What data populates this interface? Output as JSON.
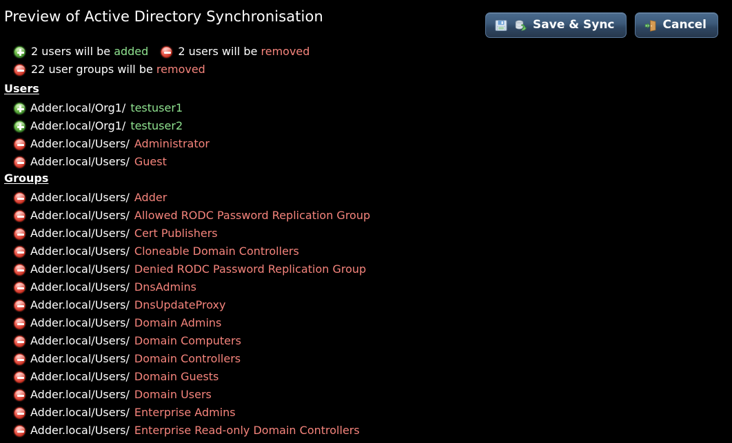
{
  "header": {
    "title": "Preview of Active Directory Synchronisation",
    "buttons": [
      {
        "label": "Save & Sync",
        "icons": [
          "floppy-disk-save-icon",
          "sync-refresh-icon"
        ]
      },
      {
        "label": "Cancel",
        "icons": [
          "exit-door-icon"
        ]
      }
    ]
  },
  "summary": {
    "lines": [
      [
        {
          "icon": "plus-circle-icon",
          "type": "add",
          "pre": "2 users will be ",
          "keyword": "added"
        },
        {
          "icon": "minus-circle-icon",
          "type": "del",
          "pre": "2 users will be ",
          "keyword": "removed"
        }
      ],
      [
        {
          "icon": "minus-circle-icon",
          "type": "del",
          "pre": "22 user groups will be ",
          "keyword": "removed"
        }
      ]
    ]
  },
  "sections": [
    {
      "title": "Users",
      "entries": [
        {
          "icon": "plus-circle-icon",
          "type": "add",
          "path": "Adder.local/Org1/",
          "name": "testuser1"
        },
        {
          "icon": "plus-circle-icon",
          "type": "add",
          "path": "Adder.local/Org1/",
          "name": "testuser2"
        },
        {
          "icon": "minus-circle-icon",
          "type": "del",
          "path": "Adder.local/Users/",
          "name": "Administrator"
        },
        {
          "icon": "minus-circle-icon",
          "type": "del",
          "path": "Adder.local/Users/",
          "name": "Guest"
        }
      ]
    },
    {
      "title": "Groups",
      "entries": [
        {
          "icon": "minus-circle-icon",
          "type": "del",
          "path": "Adder.local/Users/",
          "name": "Adder"
        },
        {
          "icon": "minus-circle-icon",
          "type": "del",
          "path": "Adder.local/Users/",
          "name": "Allowed RODC Password Replication Group"
        },
        {
          "icon": "minus-circle-icon",
          "type": "del",
          "path": "Adder.local/Users/",
          "name": "Cert Publishers"
        },
        {
          "icon": "minus-circle-icon",
          "type": "del",
          "path": "Adder.local/Users/",
          "name": "Cloneable Domain Controllers"
        },
        {
          "icon": "minus-circle-icon",
          "type": "del",
          "path": "Adder.local/Users/",
          "name": "Denied RODC Password Replication Group"
        },
        {
          "icon": "minus-circle-icon",
          "type": "del",
          "path": "Adder.local/Users/",
          "name": "DnsAdmins"
        },
        {
          "icon": "minus-circle-icon",
          "type": "del",
          "path": "Adder.local/Users/",
          "name": "DnsUpdateProxy"
        },
        {
          "icon": "minus-circle-icon",
          "type": "del",
          "path": "Adder.local/Users/",
          "name": "Domain Admins"
        },
        {
          "icon": "minus-circle-icon",
          "type": "del",
          "path": "Adder.local/Users/",
          "name": "Domain Computers"
        },
        {
          "icon": "minus-circle-icon",
          "type": "del",
          "path": "Adder.local/Users/",
          "name": "Domain Controllers"
        },
        {
          "icon": "minus-circle-icon",
          "type": "del",
          "path": "Adder.local/Users/",
          "name": "Domain Guests"
        },
        {
          "icon": "minus-circle-icon",
          "type": "del",
          "path": "Adder.local/Users/",
          "name": "Domain Users"
        },
        {
          "icon": "minus-circle-icon",
          "type": "del",
          "path": "Adder.local/Users/",
          "name": "Enterprise Admins"
        },
        {
          "icon": "minus-circle-icon",
          "type": "del",
          "path": "Adder.local/Users/",
          "name": "Enterprise Read-only Domain Controllers"
        }
      ]
    }
  ],
  "colors": {
    "background": "#000000",
    "text": "#ffffff",
    "added": "#8fe28f",
    "removed": "#f5847c",
    "button_face": "#3d5a7a"
  }
}
